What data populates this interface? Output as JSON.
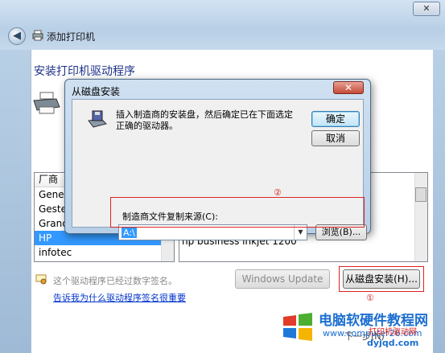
{
  "window": {
    "close_glyph": "✕",
    "back_glyph": "◀",
    "breadcrumb": "添加打印机",
    "page_title": "安装打印机驱动程序"
  },
  "manufacturer_list": {
    "header": "厂商",
    "items": [
      "Gener",
      "Gestet",
      "Grand",
      "HP",
      "infotec"
    ],
    "selected": "HP"
  },
  "printer_list": {
    "visible_item": "hp business inkjet 1200"
  },
  "signature": {
    "text": "这个驱动程序已经过数字签名。",
    "link": "告诉我为什么驱动程序签名很重要"
  },
  "buttons": {
    "windows_update": "Windows Update",
    "have_disk": "从磁盘安装(H)...",
    "next_partial": "下一步(N)"
  },
  "annotations": {
    "circle_1": "①",
    "circle_2": "②"
  },
  "dialog": {
    "title": "从磁盘安装",
    "close_glyph": "✕",
    "message": "插入制造商的安装盘，然后确定已在下面选定正确的驱动器。",
    "ok": "确定",
    "cancel": "取消",
    "copy_label": "制造商文件复制来源(C):",
    "path_value": "A:\\",
    "browse": "浏览(B)..."
  },
  "watermark": {
    "title": "电脑软硬件教程网",
    "url": "www.computer26.com",
    "subtitle": "打印机驱动网",
    "url2": "dyjqd.com"
  },
  "colors": {
    "accent_red": "#dd2222",
    "selection_blue": "#3399ff",
    "title_blue": "#1e3287"
  }
}
